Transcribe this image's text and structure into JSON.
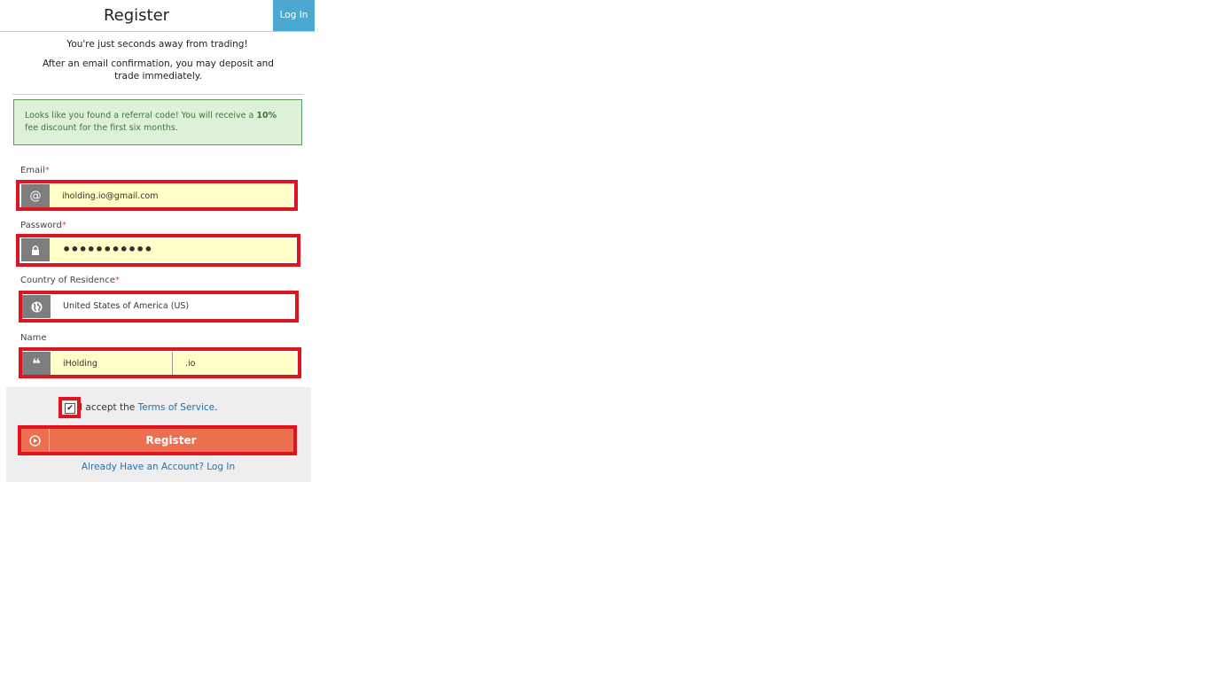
{
  "header": {
    "title": "Register",
    "login_tab": "Log In"
  },
  "intro": {
    "line1": "You're just seconds away from trading!",
    "line2": "After an email confirmation, you may deposit and trade immediately."
  },
  "referral": {
    "text_before": "Looks like you found a referral code! You will receive a ",
    "discount": "10%",
    "text_after": " fee discount for the first six months."
  },
  "form": {
    "email": {
      "label": "Email",
      "required_mark": "*",
      "value": "iholding.io@gmail.com",
      "icon": "at-icon"
    },
    "password": {
      "label": "Password",
      "required_mark": "*",
      "value": "•••••••••••",
      "icon": "lock-icon"
    },
    "country": {
      "label": "Country of Residence",
      "required_mark": "*",
      "value": "United States of America (US)",
      "icon": "globe-icon"
    },
    "name": {
      "label": "Name",
      "first": "iHolding",
      "last": ".io",
      "icon": "quote-icon"
    }
  },
  "terms": {
    "checked": true,
    "text": "I accept the ",
    "link": "Terms of Service",
    "period": "."
  },
  "register_button": {
    "label": "Register",
    "icon": "play-circle-icon"
  },
  "already_link": "Already Have an Account? Log In",
  "colors": {
    "accent_blue": "#4ba8cf",
    "register_orange": "#ec6f4f",
    "highlight_red": "#e0141e",
    "input_yellow": "#ffffc7",
    "referral_green_bg": "#dff0d8",
    "link_blue": "#2a6ea9"
  }
}
